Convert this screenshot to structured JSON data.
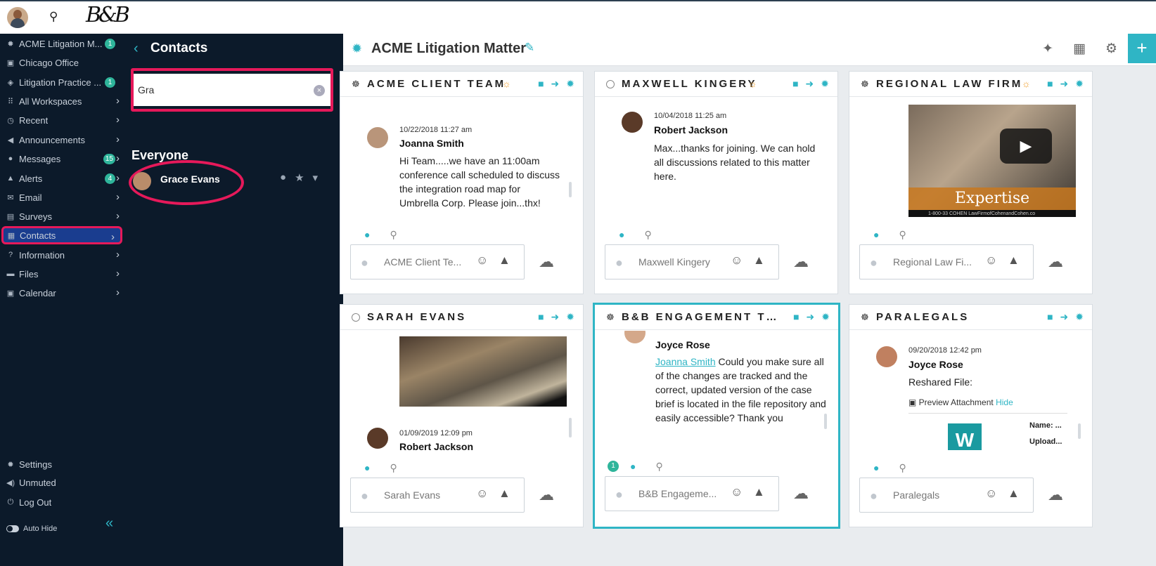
{
  "top": {
    "logo_text": "B&B"
  },
  "sidebar": {
    "items": [
      {
        "icon": "gear-icon",
        "glyph": "✹",
        "label": "ACME Litigation M...",
        "badge": "1",
        "chevron": false
      },
      {
        "icon": "briefcase-icon",
        "glyph": "▣",
        "label": "Chicago Office",
        "badge": "",
        "chevron": false
      },
      {
        "icon": "layers-icon",
        "glyph": "◈",
        "label": "Litigation Practice ...",
        "badge": "1",
        "chevron": false
      },
      {
        "icon": "grid-icon",
        "glyph": "⠿",
        "label": "All Workspaces",
        "badge": "",
        "chevron": true
      },
      {
        "icon": "clock-icon",
        "glyph": "◷",
        "label": "Recent",
        "badge": "",
        "chevron": true
      },
      {
        "icon": "megaphone-icon",
        "glyph": "◀",
        "label": "Announcements",
        "badge": "",
        "chevron": true
      },
      {
        "icon": "chat-icon",
        "glyph": "●",
        "label": "Messages",
        "badge": "15",
        "chevron": true
      },
      {
        "icon": "alert-icon",
        "glyph": "▲",
        "label": "Alerts",
        "badge": "4",
        "chevron": true
      },
      {
        "icon": "mail-icon",
        "glyph": "✉",
        "label": "Email",
        "badge": "",
        "chevron": true
      },
      {
        "icon": "clipboard-icon",
        "glyph": "▤",
        "label": "Surveys",
        "badge": "",
        "chevron": true
      },
      {
        "icon": "contacts-icon",
        "glyph": "▦",
        "label": "Contacts",
        "badge": "",
        "chevron": true
      },
      {
        "icon": "info-icon",
        "glyph": "?",
        "label": "Information",
        "badge": "",
        "chevron": true
      },
      {
        "icon": "folder-icon",
        "glyph": "▬",
        "label": "Files",
        "badge": "",
        "chevron": true
      },
      {
        "icon": "calendar-icon",
        "glyph": "▣",
        "label": "Calendar",
        "badge": "",
        "chevron": true
      }
    ],
    "footer": [
      {
        "icon": "settings-icon",
        "glyph": "✹",
        "label": "Settings"
      },
      {
        "icon": "speaker-icon",
        "glyph": "◀)",
        "label": "Unmuted"
      },
      {
        "icon": "logout-icon",
        "glyph": "⏻",
        "label": "Log Out"
      }
    ],
    "auto_hide": "Auto Hide",
    "collapse_glyph": "«"
  },
  "contacts": {
    "title": "Contacts",
    "search_value": "Gra",
    "group": "Everyone",
    "results": [
      {
        "name": "Grace Evans"
      }
    ]
  },
  "main": {
    "title": "ACME Litigation Matter",
    "cards": [
      {
        "title": "ACME CLIENT TEAM",
        "lead": "team",
        "globe": true,
        "message": {
          "date": "10/22/2018 11:27 am",
          "name": "Joanna Smith",
          "text": "Hi Team.....we have an 11:00am conference call scheduled to discuss the integration road map for Umbrella Corp. Please join...thx!"
        },
        "compose_placeholder": "ACME Client Te..."
      },
      {
        "title": "MAXWELL KINGERY",
        "lead": "circle",
        "globe": true,
        "message": {
          "date": "10/04/2018 11:25 am",
          "name": "Robert Jackson",
          "text": "Max...thanks for joining. We can hold all discussions related to this matter here."
        },
        "compose_placeholder": "Maxwell Kingery"
      },
      {
        "title": "REGIONAL LAW FIRM",
        "lead": "team",
        "globe": true,
        "video": {
          "caption": "Expertise",
          "strip": "1-800-33 COHEN        LawFirmofCohenandCohen.co"
        },
        "compose_placeholder": "Regional Law Fi..."
      },
      {
        "title": "SARAH EVANS",
        "lead": "circle",
        "globe": false,
        "message": {
          "date": "01/09/2019 12:09 pm",
          "name": "Robert Jackson",
          "text": ""
        },
        "compose_placeholder": "Sarah Evans"
      },
      {
        "title": "B&B ENGAGEMENT TE...",
        "lead": "team",
        "globe": false,
        "message": {
          "date": "",
          "name": "Joyce Rose",
          "mention": "Joanna Smith",
          "text": "Could you make sure all of the changes are tracked and the correct, updated version of the case brief is located in the file repository and easily accessible? Thank you"
        },
        "unread": "1",
        "compose_placeholder": "B&B Engageme..."
      },
      {
        "title": "PARALEGALS",
        "lead": "team",
        "globe": false,
        "message": {
          "date": "09/20/2018 12:42 pm",
          "name": "Joyce Rose",
          "text": "Reshared File:"
        },
        "attachment": {
          "label": "Preview Attachment",
          "hide": "Hide",
          "name_label": "Name: ...",
          "upload_label": "Upload...",
          "logo": "W"
        },
        "compose_placeholder": "Paralegals"
      }
    ]
  },
  "colors": {
    "accent": "#2fb5c5",
    "highlight": "#e6195a",
    "sidebar_bg": "#0c1a2a",
    "badge": "#2fb59b"
  }
}
